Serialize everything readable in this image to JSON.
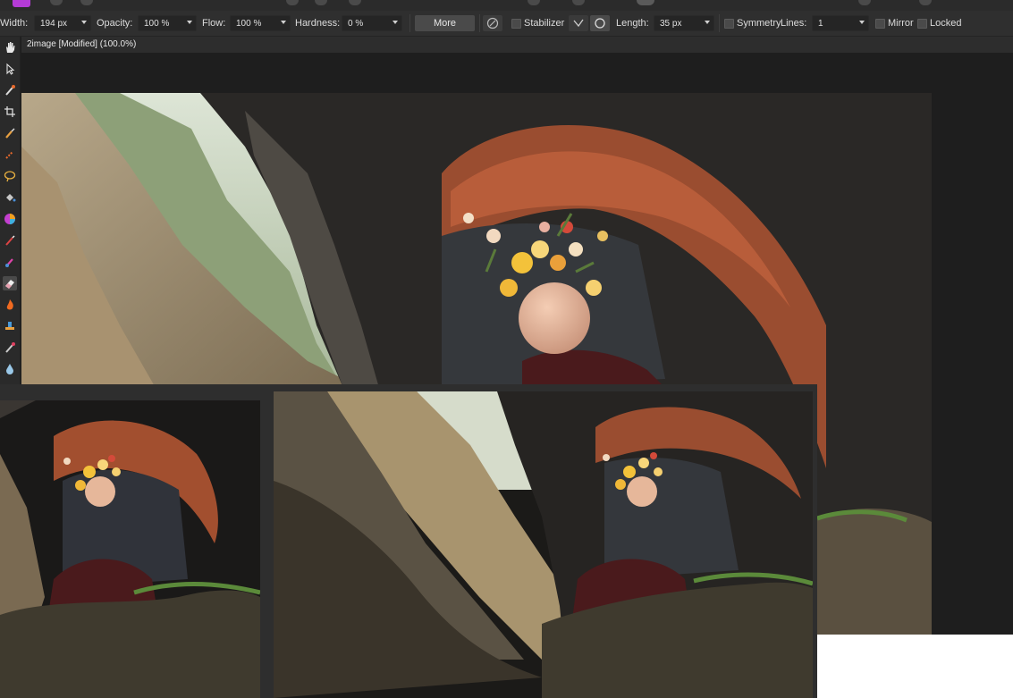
{
  "toolbar": {
    "width_label": "Width:",
    "width_value": "194 px",
    "opacity_label": "Opacity:",
    "opacity_value": "100 %",
    "flow_label": "Flow:",
    "flow_value": "100 %",
    "hardness_label": "Hardness:",
    "hardness_value": "0 %",
    "more_label": "More",
    "stabilizer_label": "Stabilizer",
    "length_label": "Length:",
    "length_value": "35 px",
    "symmetry_label": "Symmetry",
    "lines_label": "Lines:",
    "lines_value": "1",
    "mirror_label": "Mirror",
    "locked_label": "Locked"
  },
  "document": {
    "tab_title": "2image [Modified] (100.0%)"
  },
  "tools": [
    "hand-icon",
    "move-arrow-icon",
    "color-picker-icon",
    "crop-icon",
    "paint-brush-icon",
    "selection-brush-icon",
    "lasso-icon",
    "fill-bucket-icon",
    "color-wheel-icon",
    "brush-icon",
    "paint-mixer-icon",
    "eraser-icon",
    "burn-flame-icon",
    "clone-stamp-icon",
    "retouch-icon",
    "blur-drop-icon"
  ],
  "colors": {
    "accent": "#b43bd6",
    "toolbar_bg": "#2f2f2f",
    "canvas_bg": "#1e1e1e"
  }
}
